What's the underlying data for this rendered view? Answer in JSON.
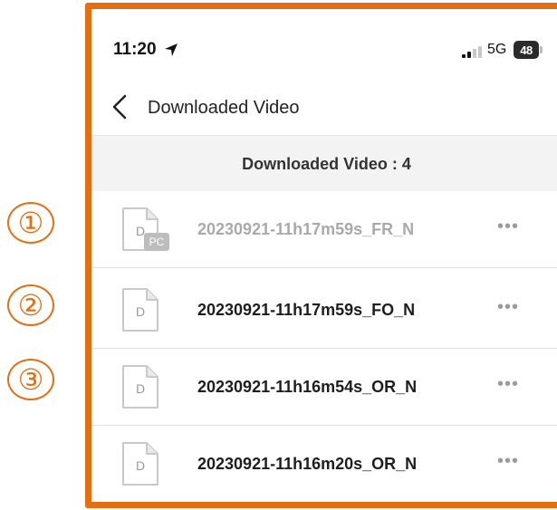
{
  "callouts": [
    "①",
    "②",
    "③"
  ],
  "status": {
    "time": "11:20",
    "network": "5G",
    "battery": "48"
  },
  "nav": {
    "title": "Downloaded Video"
  },
  "list": {
    "header": "Downloaded Video : 4",
    "items": [
      {
        "name": "20230921-11h17m59s_FR_N",
        "icon_letter": "D",
        "badge": "PC",
        "dimmed": true
      },
      {
        "name": "20230921-11h17m59s_FO_N",
        "icon_letter": "D",
        "badge": "",
        "dimmed": false
      },
      {
        "name": "20230921-11h16m54s_OR_N",
        "icon_letter": "D",
        "badge": "",
        "dimmed": false
      },
      {
        "name": "20230921-11h16m20s_OR_N",
        "icon_letter": "D",
        "badge": "",
        "dimmed": false
      }
    ],
    "more_label": "•••"
  },
  "colors": {
    "annotation": "#e36f12",
    "dimmed_text": "#a9a9a9"
  }
}
